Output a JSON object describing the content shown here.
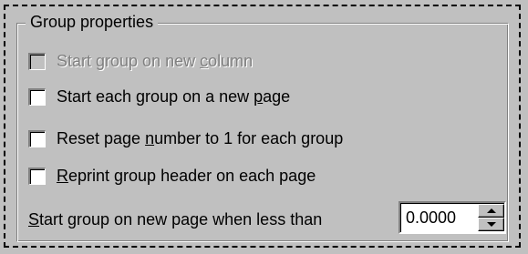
{
  "group": {
    "title": "Group properties"
  },
  "options": {
    "new_column": {
      "before": "Start group on new ",
      "underlined": "c",
      "after": "olumn",
      "checked": false,
      "enabled": false
    },
    "new_page": {
      "before": "Start each group on a new ",
      "underlined": "p",
      "after": "age",
      "checked": false,
      "enabled": true
    },
    "reset_page": {
      "before": "Reset page ",
      "underlined": "n",
      "after": "umber to 1 for each group",
      "checked": false,
      "enabled": true
    },
    "reprint_header": {
      "before": "",
      "underlined": "R",
      "after": "eprint group header on each page",
      "checked": false,
      "enabled": true
    }
  },
  "less_than": {
    "underlined": "S",
    "after": "tart group on new page when less than",
    "value": "0.0000"
  },
  "icons": {
    "up": "spin-up-arrow",
    "down": "spin-down-arrow"
  }
}
